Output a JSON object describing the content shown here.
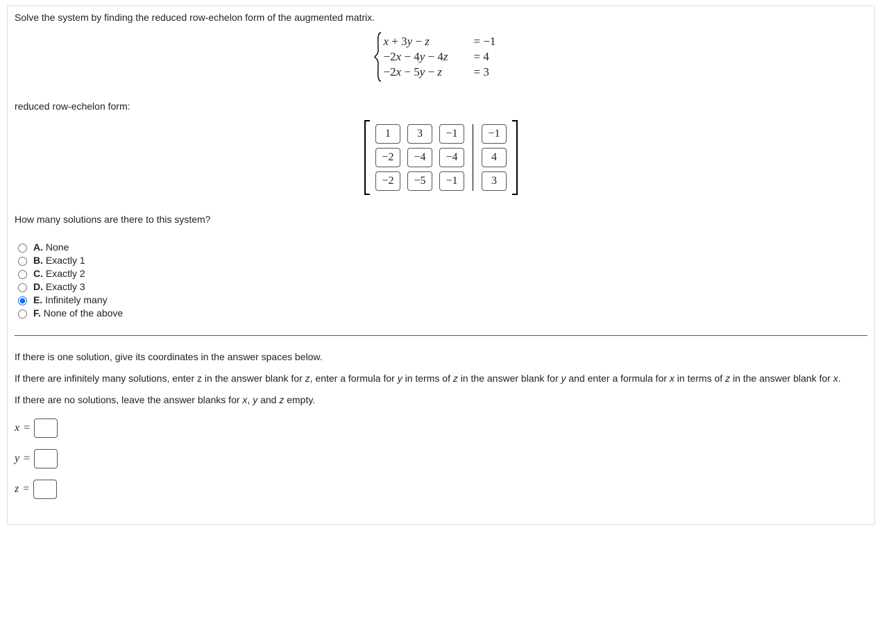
{
  "prompt": "Solve the system by finding the reduced row-echelon form of the augmented matrix.",
  "equations": [
    {
      "lhs_html": "<span class='mi'>x</span> + 3<span class='mi'>y</span> − <span class='mi'>z</span>",
      "rhs": "= −1"
    },
    {
      "lhs_html": "−2<span class='mi'>x</span> − 4<span class='mi'>y</span> − 4<span class='mi'>z</span>",
      "rhs": "= 4"
    },
    {
      "lhs_html": "−2<span class='mi'>x</span> − 5<span class='mi'>y</span> − <span class='mi'>z</span>",
      "rhs": "= 3"
    }
  ],
  "rref_label": "reduced row-echelon form:",
  "matrix": {
    "rows": [
      [
        "1",
        "3",
        "-1"
      ],
      [
        "-2",
        "-4",
        "-4"
      ],
      [
        "-2",
        "-5",
        "-1"
      ]
    ],
    "aug": [
      "-1",
      "4",
      "3"
    ]
  },
  "question": "How many solutions are there to this system?",
  "options": [
    {
      "key": "A",
      "text": "None"
    },
    {
      "key": "B",
      "text": "Exactly 1"
    },
    {
      "key": "C",
      "text": "Exactly 2"
    },
    {
      "key": "D",
      "text": "Exactly 3"
    },
    {
      "key": "E",
      "text": "Infinitely many"
    },
    {
      "key": "F",
      "text": "None of the above"
    }
  ],
  "selected_option": "E",
  "instructions": {
    "p1": "If there is one solution, give its coordinates in the answer spaces below.",
    "p2_html": "If there are infinitely many solutions, enter z in the answer blank for <span class='mi'>z</span>, enter a formula for <span class='mi'>y</span> in terms of <span class='mi'>z</span> in the answer blank for <span class='mi'>y</span> and enter a formula for <span class='mi'>x</span> in terms of <span class='mi'>z</span> in the answer blank for <span class='mi'>x</span>.",
    "p3_html": "If there are no solutions, leave the answer blanks for <span class='mi'>x</span>, <span class='mi'>y</span> and <span class='mi'>z</span> empty."
  },
  "answers": {
    "x": {
      "label": "x =",
      "value": ""
    },
    "y": {
      "label": "y =",
      "value": ""
    },
    "z": {
      "label": "z =",
      "value": ""
    }
  }
}
